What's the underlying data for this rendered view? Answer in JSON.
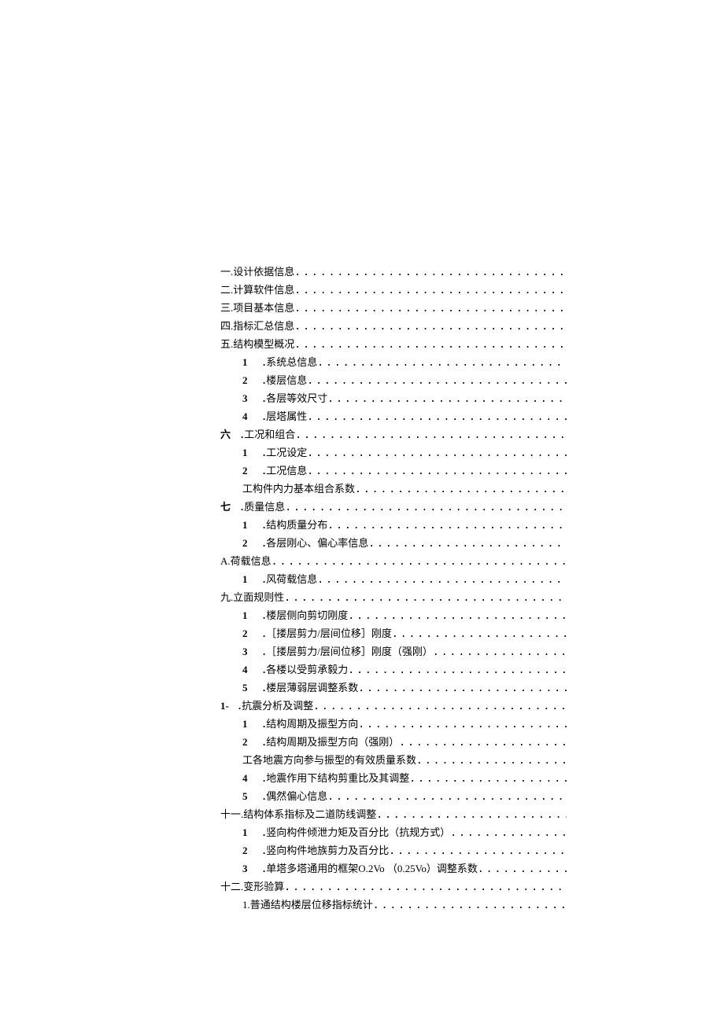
{
  "toc": [
    {
      "indent": 0,
      "num": "",
      "prefix": "一. ",
      "label": "设计依据信息"
    },
    {
      "indent": 0,
      "num": "",
      "prefix": "二. ",
      "label": "计算软件信息"
    },
    {
      "indent": 0,
      "num": "",
      "prefix": "三. ",
      "label": "项目基本信息"
    },
    {
      "indent": 0,
      "num": "",
      "prefix": "四. ",
      "label": "指标汇总信息"
    },
    {
      "indent": 0,
      "num": "",
      "prefix": "五. ",
      "label": "结构模型概况"
    },
    {
      "indent": 1,
      "num": "1",
      "prefix": "",
      "dot": true,
      "label": "系统总信息"
    },
    {
      "indent": 1,
      "num": "2",
      "prefix": "",
      "dot": true,
      "label": "楼层信息"
    },
    {
      "indent": 1,
      "num": "3",
      "prefix": "",
      "dot": true,
      "label": "各层等效尺寸"
    },
    {
      "indent": 1,
      "num": "4",
      "prefix": "",
      "dot": true,
      "label": "层塔属性"
    },
    {
      "indent": 0,
      "num": "六",
      "prefix": "",
      "dot": true,
      "label": "工况和组合"
    },
    {
      "indent": 1,
      "num": "1",
      "prefix": "",
      "dot": true,
      "label": "工况设定"
    },
    {
      "indent": 1,
      "num": "2",
      "prefix": "",
      "dot": true,
      "label": "工况信息"
    },
    {
      "indent": 1,
      "num": "",
      "prefix": "工 ",
      "label": "构件内力基本组合系数"
    },
    {
      "indent": 0,
      "num": "七",
      "prefix": "",
      "dot": true,
      "label": "质量信息"
    },
    {
      "indent": 1,
      "num": "1",
      "prefix": "",
      "dot": true,
      "label": "结构质量分布"
    },
    {
      "indent": 1,
      "num": "2",
      "prefix": "",
      "dot": true,
      "label": "各层刚心、偏心率信息"
    },
    {
      "indent": 0,
      "num": "",
      "prefix": "A. ",
      "label": "荷载信息"
    },
    {
      "indent": 1,
      "num": "1",
      "prefix": "",
      "dot": true,
      "label": "风荷载信息"
    },
    {
      "indent": 0,
      "num": "",
      "prefix": "九. ",
      "label": "立面规则性"
    },
    {
      "indent": 1,
      "num": "1",
      "prefix": "",
      "dot": true,
      "label": "楼层侧向剪切刚度"
    },
    {
      "indent": 1,
      "num": "2",
      "prefix": "",
      "dot": true,
      "label": "［搂层剪力/层间位移］刚度"
    },
    {
      "indent": 1,
      "num": "3",
      "prefix": "",
      "dot": true,
      "label": "［搂层剪力/层间位移］刚度（强刚）"
    },
    {
      "indent": 1,
      "num": "4",
      "prefix": "",
      "dot": true,
      "label": "各楼以受剪承毅力"
    },
    {
      "indent": 1,
      "num": "5",
      "prefix": "",
      "dot": true,
      "label": "楼层薄弱层调整系数"
    },
    {
      "indent": 0,
      "num": "1-",
      "prefix": "",
      "dot": true,
      "label": "抗震分析及调整"
    },
    {
      "indent": 1,
      "num": "1",
      "prefix": "",
      "dot": true,
      "label": "结构周期及振型方向"
    },
    {
      "indent": 1,
      "num": "2",
      "prefix": "",
      "dot": true,
      "label": "结构周期及振型方向（强刚）"
    },
    {
      "indent": 1,
      "num": "",
      "prefix": "工 ",
      "label": "各地震方向参与振型的有效质量系数"
    },
    {
      "indent": 1,
      "num": "4",
      "prefix": "",
      "dot": true,
      "label": "地震作用下结构剪重比及其调整"
    },
    {
      "indent": 1,
      "num": "5",
      "prefix": "",
      "dot": true,
      "label": "偶然偏心信息"
    },
    {
      "indent": 0,
      "num": "",
      "prefix": "十一. ",
      "label": "结构体系指标及二道防线调整"
    },
    {
      "indent": 1,
      "num": "1",
      "prefix": "",
      "dot": true,
      "label": "竖向构件倾泄力矩及百分比（抗规方式）"
    },
    {
      "indent": 1,
      "num": "2",
      "prefix": "",
      "dot": true,
      "label": "竖向构件地族剪力及百分比"
    },
    {
      "indent": 1,
      "num": "3",
      "prefix": "",
      "dot": true,
      "label": "单塔多塔通用的框架O.2Vo （0.25Vo）调整系数"
    },
    {
      "indent": 0,
      "num": "",
      "prefix": "十二. ",
      "label": "变形验算"
    },
    {
      "indent": 1,
      "num": "",
      "prefix": "1. ",
      "label": "普通结构楼层位移指标统计"
    }
  ]
}
